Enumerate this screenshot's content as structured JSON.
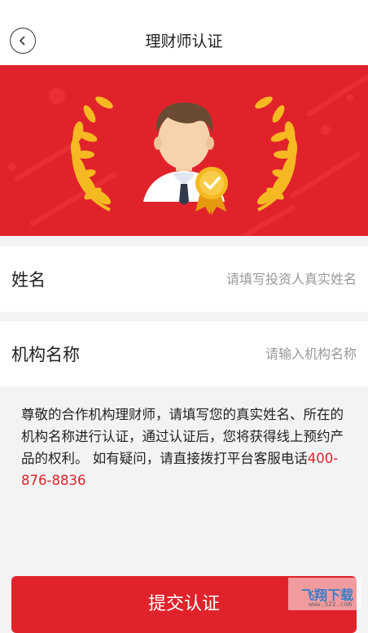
{
  "header": {
    "title": "理财师认证"
  },
  "form": {
    "name": {
      "label": "姓名",
      "placeholder": "请填写投资人真实姓名",
      "value": ""
    },
    "institution": {
      "label": "机构名称",
      "placeholder": "请输入机构名称",
      "value": ""
    }
  },
  "notice": {
    "text": "尊敬的合作机构理财师，请填写您的真实姓名、所在的机构名称进行认证，通过认证后，您将获得线上预约产品的权利。 如有疑问，请直接拨打平台客服电话",
    "phone": "400-876-8836"
  },
  "submit_label": "提交认证",
  "watermark": {
    "main": "飞翔下载",
    "sub": "www.52z.com"
  },
  "colors": {
    "accent": "#e0232b",
    "banner_bg": "#e0232b",
    "laurel": "#f5b921",
    "placeholder": "#999999"
  }
}
